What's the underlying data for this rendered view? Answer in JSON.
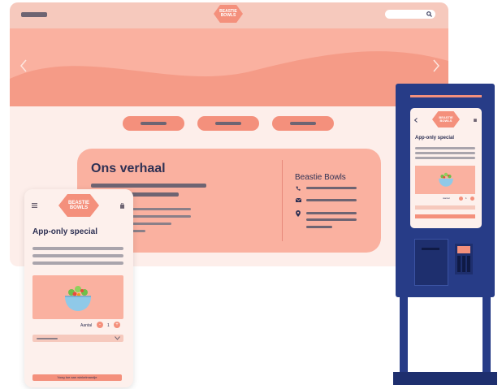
{
  "brand": {
    "line1": "BEASTIE",
    "line2": "BOWLS"
  },
  "desktop": {
    "story_title": "Ons verhaal",
    "contact_title": "Beastie Bowls"
  },
  "phone": {
    "special_title": "App-only special",
    "quantity_label": "Aantal",
    "quantity_minus": "-",
    "quantity_value": "1",
    "quantity_plus": "+",
    "cart_button": "Voeg toe aan winkelmandje"
  },
  "kiosk": {
    "special_title": "App-only special",
    "quantity_label": "Aantal",
    "quantity_value": "1"
  },
  "colors": {
    "brand_salmon": "#f4907c",
    "hero_pink": "#fab1a0",
    "kiosk_blue": "#273c87",
    "text_navy": "#2e3154"
  },
  "icons": [
    "hamburger-icon",
    "search-icon",
    "chevron-left-icon",
    "chevron-right-icon",
    "phone-icon",
    "mail-icon",
    "location-pin-icon",
    "cart-icon",
    "salad-bowl-icon"
  ]
}
